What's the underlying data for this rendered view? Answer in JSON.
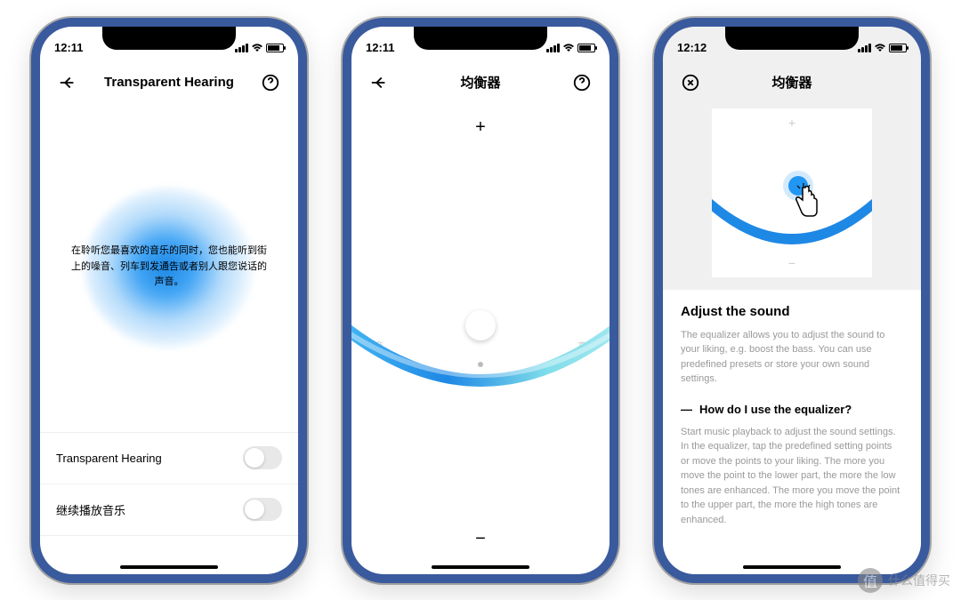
{
  "phone1": {
    "time": "12:11",
    "title": "Transparent Hearing",
    "description": "在聆听您最喜欢的音乐的同时，您也能听到街上的噪音、列车到发通告或者别人跟您说话的声音。",
    "setting1": "Transparent Hearing",
    "setting2": "继续播放音乐"
  },
  "phone2": {
    "time": "12:11",
    "title": "均衡器",
    "plus": "+",
    "minus": "−",
    "label_left": "低音",
    "label_right": "高音"
  },
  "phone3": {
    "time": "12:12",
    "title": "均衡器",
    "tut_plus": "+",
    "tut_minus": "−",
    "heading": "Adjust the sound",
    "body": "The equalizer allows you to adjust the sound to your liking, e.g. boost the bass. You can use predefined presets or store your own sound settings.",
    "faq_dash": "—",
    "faq_title": "How do I use the equalizer?",
    "faq_body": "Start music playback to adjust the sound settings. In the equalizer, tap the predefined setting points or move the points to your liking. The more you move the point to the lower part, the more the low tones are enhanced. The more you move the point to the upper part, the more the high tones are enhanced."
  },
  "watermark": {
    "badge": "值",
    "text": "什么值得买"
  }
}
